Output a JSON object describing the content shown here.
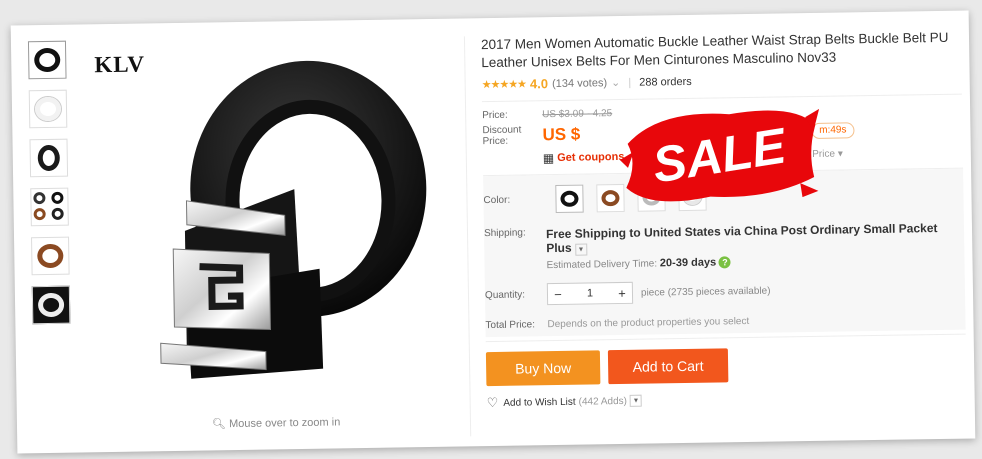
{
  "brand": "KLV",
  "zoom_hint": "Mouse over to zoom in",
  "title": "2017 Men Women Automatic Buckle Leather Waist Strap Belts Buckle Belt PU Leather Unisex Belts For Men Cinturones Masculino Nov33",
  "rating": {
    "stars": "★★★★★",
    "value": "4.0",
    "votes": "(134 votes)",
    "orders": "288 orders"
  },
  "price": {
    "label": "Price:",
    "original": "US $3.09 - 4.25",
    "discount_label": "Discount Price:",
    "discount_prefix": "US $",
    "timer": "m:49s"
  },
  "coupon": {
    "text": "Get coupons",
    "bulk": "Bulk Price"
  },
  "color": {
    "label": "Color:"
  },
  "shipping": {
    "label": "Shipping:",
    "text": "Free Shipping to United States via China Post Ordinary Small Packet Plus",
    "eta_label": "Estimated Delivery Time:",
    "eta_value": "20-39 days"
  },
  "quantity": {
    "label": "Quantity:",
    "minus": "−",
    "value": "1",
    "plus": "+",
    "note": "piece (2735 pieces available)"
  },
  "total": {
    "label": "Total Price:",
    "text": "Depends on the product properties you select"
  },
  "buttons": {
    "buy": "Buy Now",
    "cart": "Add to Cart"
  },
  "wishlist": {
    "text": "Add to Wish List",
    "count": "(442 Adds)"
  },
  "overlay": "SALE",
  "colors": {
    "accent": "#ff6600",
    "buy": "#f39220",
    "cart": "#f2571d",
    "sale_red": "#e8070b"
  }
}
